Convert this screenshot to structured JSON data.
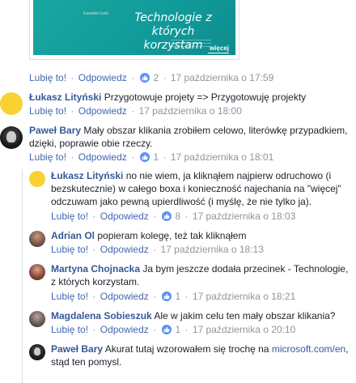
{
  "preview": {
    "title_line1": "Technologie z których",
    "title_line2": "korzystam",
    "more": "więcej",
    "small_text": "Kawałek kodu"
  },
  "actions": {
    "like": "Lubię to!",
    "reply": "Odpowiedz",
    "dot": "·"
  },
  "comments": [
    {
      "likes": "2",
      "time": "17 października o 17:59"
    },
    {
      "author": "Łukasz Lityński",
      "text": "Przygotowuje projety => Przygotowuję projekty",
      "time": "17 października o 18:00"
    },
    {
      "author": "Paweł Bary",
      "text": "Mały obszar klikania zrobiłem celowo, literówkę przypadkiem, dzięki, poprawie obie rzeczy.",
      "likes": "1",
      "time": "17 października o 18:01"
    },
    {
      "author": "Łukasz Lityński",
      "text": "no nie wiem, ja kliknąłem najpierw odruchowo (i bezskutecznie) w całego boxa i konieczność najechania na \"więcej\" odczuwam jako pewną upierdliwość (i myślę, że nie tylko ja).",
      "likes": "8",
      "time": "17 października o 18:03"
    },
    {
      "author": "Adrian Ol",
      "text": "popieram kolegę, też tak kliknąłem",
      "time": "17 października o 18:13"
    },
    {
      "author": "Martyna Chojnacka",
      "text": "Ja bym jeszcze dodała przecinek - Technologie, z których korzystam.",
      "likes": "1",
      "time": "17 października o 18:21"
    },
    {
      "author": "Magdalena Sobieszuk",
      "text": "Ale w jakim celu ten mały obszar klikania?",
      "likes": "1",
      "time": "17 października o 20:10"
    },
    {
      "author": "Paweł Bary",
      "text_before": "Akurat tutaj wzorowałem się trochę na",
      "link": "microsoft.com/en",
      "text_after": ", stąd ten pomysl."
    }
  ],
  "colors": {
    "link_blue": "#365899",
    "action_blue": "#4267b2",
    "meta_gray": "#90949c",
    "like_blue": "#5890ff",
    "preview_teal": "#1aa6a0"
  }
}
